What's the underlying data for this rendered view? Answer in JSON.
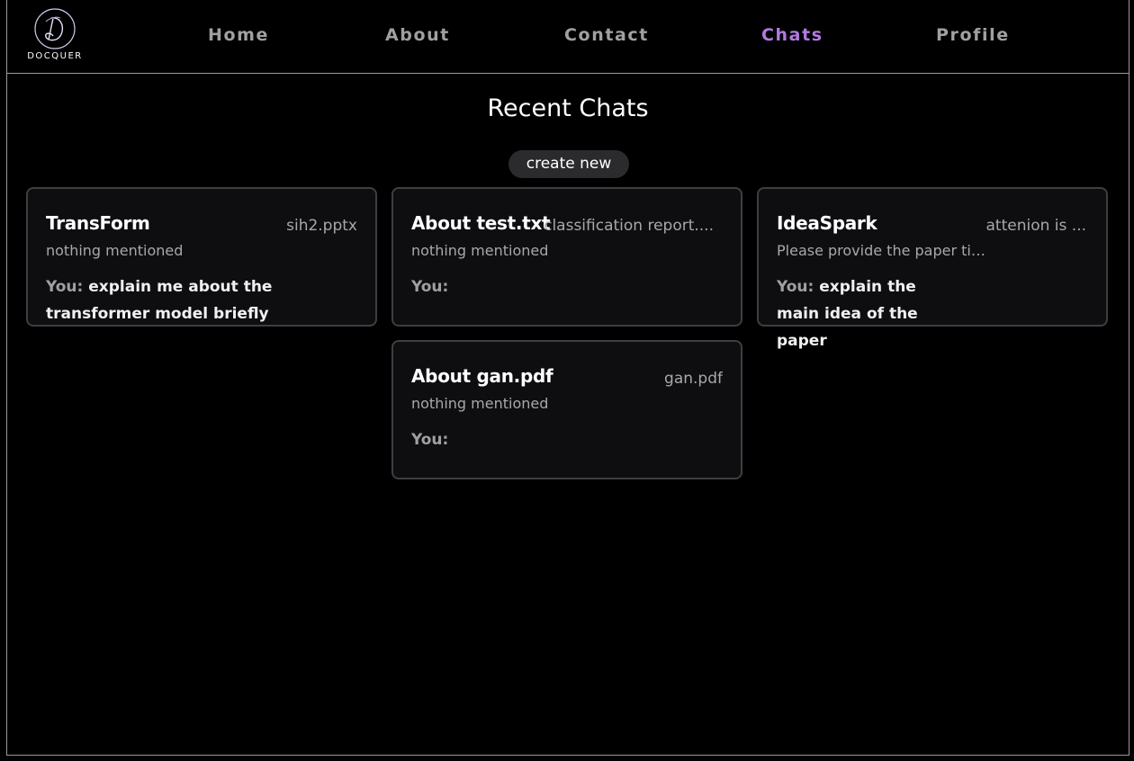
{
  "brand": {
    "name": "DOCQUER",
    "logo_icon": "script-d-logo"
  },
  "nav": {
    "items": [
      {
        "label": "Home",
        "active": false
      },
      {
        "label": "About",
        "active": false
      },
      {
        "label": "Contact",
        "active": false
      },
      {
        "label": "Chats",
        "active": true
      },
      {
        "label": "Profile",
        "active": false
      }
    ],
    "active_color": "#b07ae0"
  },
  "page": {
    "title": "Recent Chats",
    "create_label": "create new"
  },
  "chats": [
    {
      "title": "TransForm",
      "file": "sih2.pptx",
      "description": "nothing mentioned",
      "you_label": "You:",
      "last_message": "explain me about the transformer model briefly"
    },
    {
      "title": "About test.txt",
      "file": "classification report....",
      "description": "nothing mentioned",
      "you_label": "You:",
      "last_message": ""
    },
    {
      "title": "IdeaSpark",
      "file": "attenion is ...",
      "description": "Please provide the paper titl...",
      "you_label": "You:",
      "last_message": "explain the main idea of the paper"
    },
    {
      "title": "About gan.pdf",
      "file": "gan.pdf",
      "description": "nothing mentioned",
      "you_label": "You:",
      "last_message": ""
    }
  ]
}
